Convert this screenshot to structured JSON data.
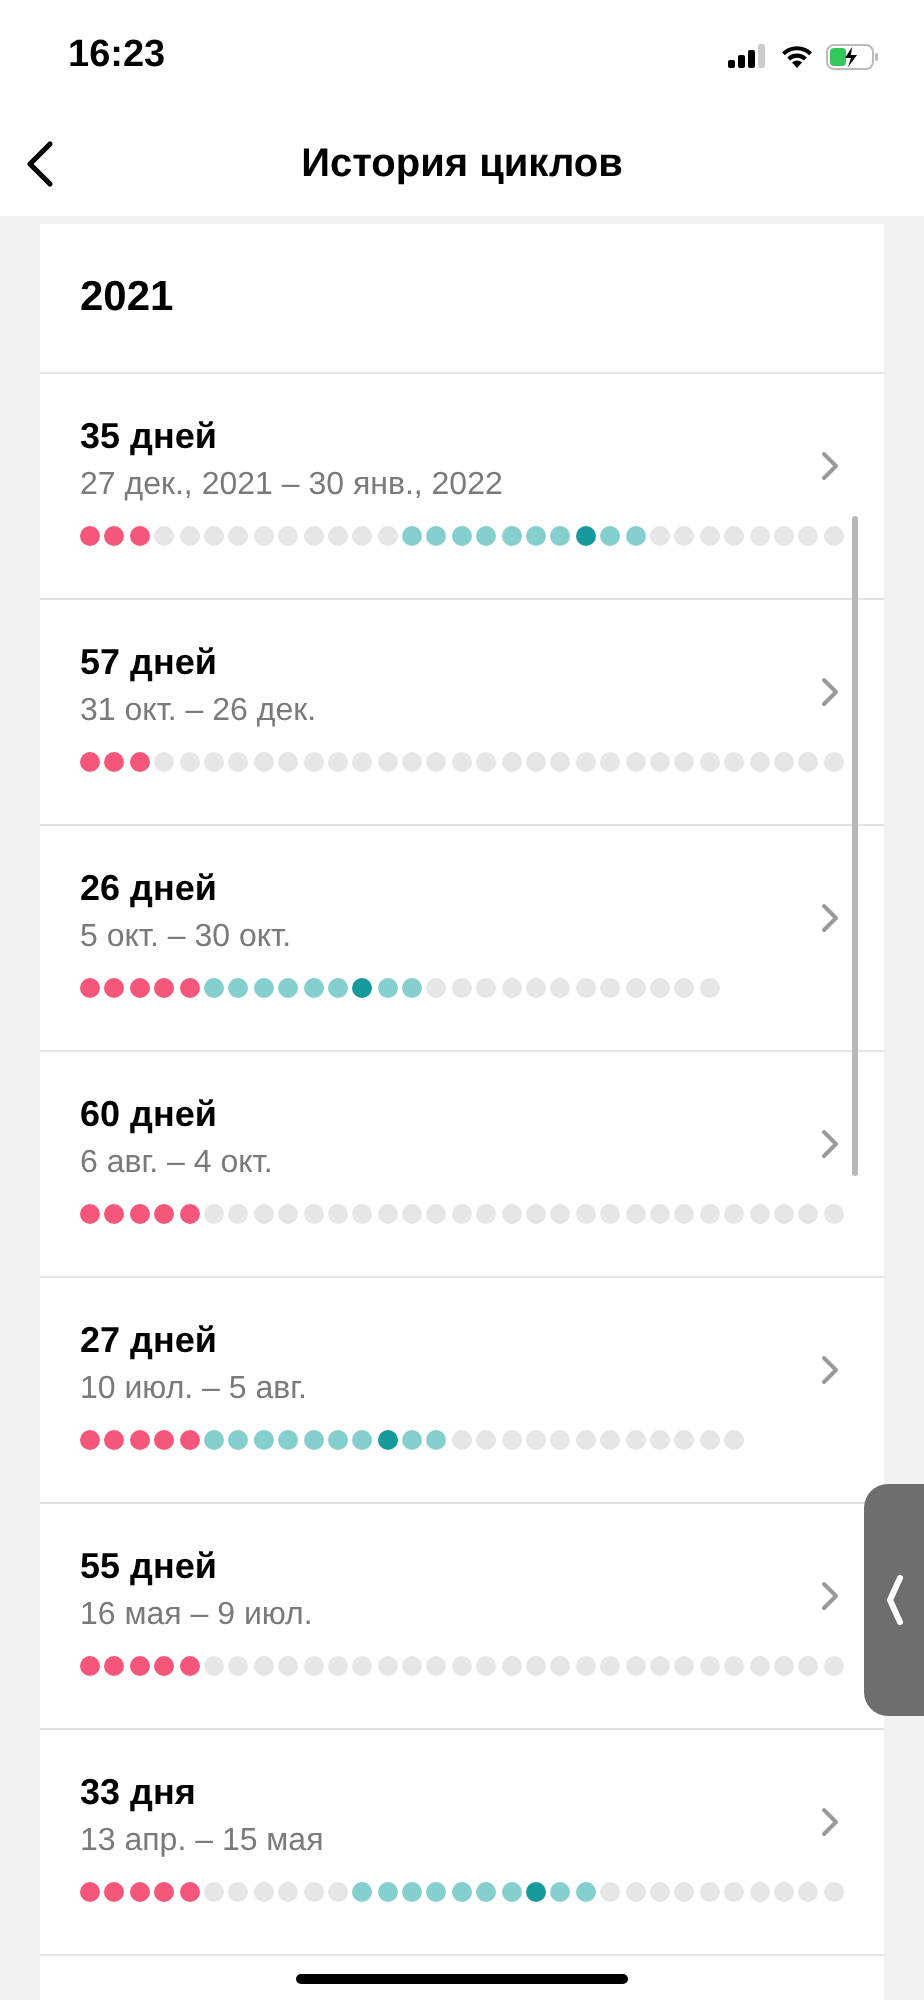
{
  "status_bar": {
    "time": "16:23"
  },
  "nav": {
    "title": "История циклов"
  },
  "year": "2021",
  "cycles": [
    {
      "length": "35 дней",
      "dates": "27 дек., 2021 – 30 янв., 2022",
      "days": [
        {
          "kind": "period"
        },
        {
          "kind": "period"
        },
        {
          "kind": "period"
        },
        {
          "kind": "none"
        },
        {
          "kind": "none"
        },
        {
          "kind": "none"
        },
        {
          "kind": "none"
        },
        {
          "kind": "none"
        },
        {
          "kind": "none"
        },
        {
          "kind": "none"
        },
        {
          "kind": "none"
        },
        {
          "kind": "none"
        },
        {
          "kind": "none"
        },
        {
          "kind": "fertile"
        },
        {
          "kind": "fertile"
        },
        {
          "kind": "fertile"
        },
        {
          "kind": "fertile"
        },
        {
          "kind": "fertile"
        },
        {
          "kind": "fertile"
        },
        {
          "kind": "fertile"
        },
        {
          "kind": "ovulation"
        },
        {
          "kind": "fertile"
        },
        {
          "kind": "fertile"
        },
        {
          "kind": "none"
        },
        {
          "kind": "none"
        },
        {
          "kind": "none"
        },
        {
          "kind": "none"
        },
        {
          "kind": "none"
        },
        {
          "kind": "none"
        },
        {
          "kind": "none"
        },
        {
          "kind": "none"
        }
      ]
    },
    {
      "length": "57 дней",
      "dates": "31 окт. – 26 дек.",
      "days": [
        {
          "kind": "period"
        },
        {
          "kind": "period"
        },
        {
          "kind": "period"
        },
        {
          "kind": "none"
        },
        {
          "kind": "none"
        },
        {
          "kind": "none"
        },
        {
          "kind": "none"
        },
        {
          "kind": "none"
        },
        {
          "kind": "none"
        },
        {
          "kind": "none"
        },
        {
          "kind": "none"
        },
        {
          "kind": "none"
        },
        {
          "kind": "none"
        },
        {
          "kind": "none"
        },
        {
          "kind": "none"
        },
        {
          "kind": "none"
        },
        {
          "kind": "none"
        },
        {
          "kind": "none"
        },
        {
          "kind": "none"
        },
        {
          "kind": "none"
        },
        {
          "kind": "none"
        },
        {
          "kind": "none"
        },
        {
          "kind": "none"
        },
        {
          "kind": "none"
        },
        {
          "kind": "none"
        },
        {
          "kind": "none"
        },
        {
          "kind": "none"
        },
        {
          "kind": "none"
        },
        {
          "kind": "none"
        },
        {
          "kind": "none"
        },
        {
          "kind": "none"
        }
      ]
    },
    {
      "length": "26 дней",
      "dates": "5 окт. – 30 окт.",
      "days": [
        {
          "kind": "period"
        },
        {
          "kind": "period"
        },
        {
          "kind": "period"
        },
        {
          "kind": "period"
        },
        {
          "kind": "period"
        },
        {
          "kind": "fertile"
        },
        {
          "kind": "fertile"
        },
        {
          "kind": "fertile"
        },
        {
          "kind": "fertile"
        },
        {
          "kind": "fertile"
        },
        {
          "kind": "fertile"
        },
        {
          "kind": "ovulation"
        },
        {
          "kind": "fertile"
        },
        {
          "kind": "fertile"
        },
        {
          "kind": "none"
        },
        {
          "kind": "none"
        },
        {
          "kind": "none"
        },
        {
          "kind": "none"
        },
        {
          "kind": "none"
        },
        {
          "kind": "none"
        },
        {
          "kind": "none"
        },
        {
          "kind": "none"
        },
        {
          "kind": "none"
        },
        {
          "kind": "none"
        },
        {
          "kind": "none"
        },
        {
          "kind": "none"
        }
      ]
    },
    {
      "length": "60 дней",
      "dates": "6 авг. – 4 окт.",
      "days": [
        {
          "kind": "period"
        },
        {
          "kind": "period"
        },
        {
          "kind": "period"
        },
        {
          "kind": "period"
        },
        {
          "kind": "period"
        },
        {
          "kind": "none"
        },
        {
          "kind": "none"
        },
        {
          "kind": "none"
        },
        {
          "kind": "none"
        },
        {
          "kind": "none"
        },
        {
          "kind": "none"
        },
        {
          "kind": "none"
        },
        {
          "kind": "none"
        },
        {
          "kind": "none"
        },
        {
          "kind": "none"
        },
        {
          "kind": "none"
        },
        {
          "kind": "none"
        },
        {
          "kind": "none"
        },
        {
          "kind": "none"
        },
        {
          "kind": "none"
        },
        {
          "kind": "none"
        },
        {
          "kind": "none"
        },
        {
          "kind": "none"
        },
        {
          "kind": "none"
        },
        {
          "kind": "none"
        },
        {
          "kind": "none"
        },
        {
          "kind": "none"
        },
        {
          "kind": "none"
        },
        {
          "kind": "none"
        },
        {
          "kind": "none"
        },
        {
          "kind": "none"
        }
      ]
    },
    {
      "length": "27 дней",
      "dates": "10 июл. – 5 авг.",
      "days": [
        {
          "kind": "period"
        },
        {
          "kind": "period"
        },
        {
          "kind": "period"
        },
        {
          "kind": "period"
        },
        {
          "kind": "period"
        },
        {
          "kind": "fertile"
        },
        {
          "kind": "fertile"
        },
        {
          "kind": "fertile"
        },
        {
          "kind": "fertile"
        },
        {
          "kind": "fertile"
        },
        {
          "kind": "fertile"
        },
        {
          "kind": "fertile"
        },
        {
          "kind": "ovulation"
        },
        {
          "kind": "fertile"
        },
        {
          "kind": "fertile"
        },
        {
          "kind": "none"
        },
        {
          "kind": "none"
        },
        {
          "kind": "none"
        },
        {
          "kind": "none"
        },
        {
          "kind": "none"
        },
        {
          "kind": "none"
        },
        {
          "kind": "none"
        },
        {
          "kind": "none"
        },
        {
          "kind": "none"
        },
        {
          "kind": "none"
        },
        {
          "kind": "none"
        },
        {
          "kind": "none"
        }
      ]
    },
    {
      "length": "55 дней",
      "dates": "16 мая – 9 июл.",
      "days": [
        {
          "kind": "period"
        },
        {
          "kind": "period"
        },
        {
          "kind": "period"
        },
        {
          "kind": "period"
        },
        {
          "kind": "period"
        },
        {
          "kind": "none"
        },
        {
          "kind": "none"
        },
        {
          "kind": "none"
        },
        {
          "kind": "none"
        },
        {
          "kind": "none"
        },
        {
          "kind": "none"
        },
        {
          "kind": "none"
        },
        {
          "kind": "none"
        },
        {
          "kind": "none"
        },
        {
          "kind": "none"
        },
        {
          "kind": "none"
        },
        {
          "kind": "none"
        },
        {
          "kind": "none"
        },
        {
          "kind": "none"
        },
        {
          "kind": "none"
        },
        {
          "kind": "none"
        },
        {
          "kind": "none"
        },
        {
          "kind": "none"
        },
        {
          "kind": "none"
        },
        {
          "kind": "none"
        },
        {
          "kind": "none"
        },
        {
          "kind": "none"
        },
        {
          "kind": "none"
        },
        {
          "kind": "none"
        },
        {
          "kind": "none"
        },
        {
          "kind": "none"
        }
      ]
    },
    {
      "length": "33 дня",
      "dates": "13 апр. – 15 мая",
      "days": [
        {
          "kind": "period"
        },
        {
          "kind": "period"
        },
        {
          "kind": "period"
        },
        {
          "kind": "period"
        },
        {
          "kind": "period"
        },
        {
          "kind": "none"
        },
        {
          "kind": "none"
        },
        {
          "kind": "none"
        },
        {
          "kind": "none"
        },
        {
          "kind": "none"
        },
        {
          "kind": "none"
        },
        {
          "kind": "fertile"
        },
        {
          "kind": "fertile"
        },
        {
          "kind": "fertile"
        },
        {
          "kind": "fertile"
        },
        {
          "kind": "fertile"
        },
        {
          "kind": "fertile"
        },
        {
          "kind": "fertile"
        },
        {
          "kind": "ovulation"
        },
        {
          "kind": "fertile"
        },
        {
          "kind": "fertile"
        },
        {
          "kind": "none"
        },
        {
          "kind": "none"
        },
        {
          "kind": "none"
        },
        {
          "kind": "none"
        },
        {
          "kind": "none"
        },
        {
          "kind": "none"
        },
        {
          "kind": "none"
        },
        {
          "kind": "none"
        },
        {
          "kind": "none"
        },
        {
          "kind": "none"
        }
      ]
    }
  ]
}
